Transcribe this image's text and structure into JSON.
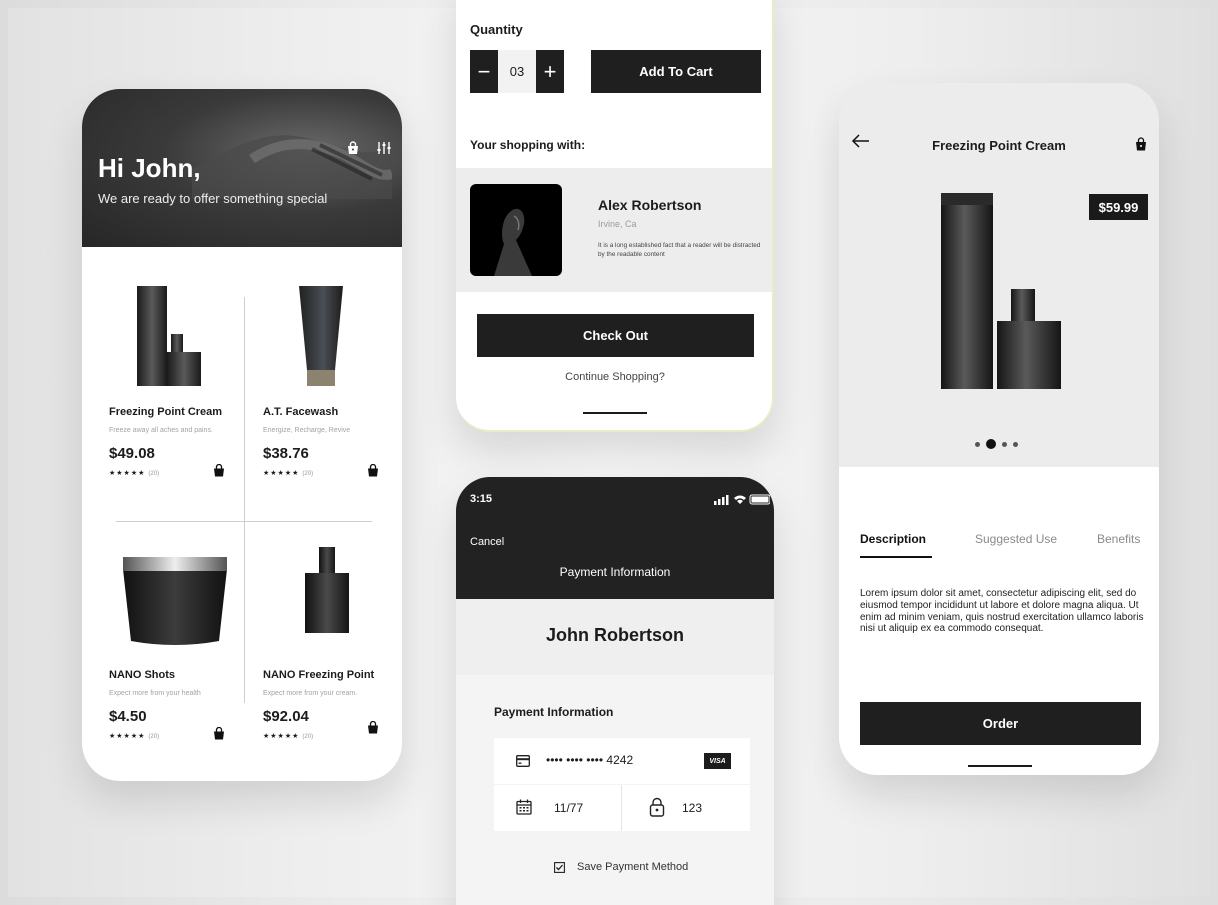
{
  "theme": {
    "dark": "#1f1f1f",
    "accent_border": "#e3efc6"
  },
  "home": {
    "greeting": "Hi John,",
    "subtitle": "We are ready to offer something special",
    "icons": [
      "shopping-bag-icon",
      "filter-icon"
    ],
    "products": [
      {
        "name": "Freezing Point Cream",
        "tagline": "Freeze away all aches and pains.",
        "price": "$49.08",
        "stars": "★★★★★",
        "reviews": "(20)"
      },
      {
        "name": "A.T. Facewash",
        "tagline": "Energize, Recharge, Revive",
        "price": "$38.76",
        "stars": "★★★★★",
        "reviews": "(20)"
      },
      {
        "name": "NANO Shots",
        "tagline": "Expect more from your health",
        "price": "$4.50",
        "stars": "★★★★★",
        "reviews": "(20)"
      },
      {
        "name": "NANO Freezing Point",
        "tagline": "Expect more from your cream.",
        "price": "$92.04",
        "stars": "★★★★★",
        "reviews": "(20)"
      }
    ]
  },
  "cart": {
    "quantity_label": "Quantity",
    "quantity_minus": "−",
    "quantity_value": "03",
    "quantity_plus": "+",
    "add_to_cart": "Add To Cart",
    "shopping_with_label": "Your shopping with:",
    "seller": {
      "name": "Alex Robertson",
      "location": "Irvine, Ca",
      "description": "It is a long established fact that a reader will be distracted by the readable content"
    },
    "checkout": "Check Out",
    "continue": "Continue Shopping?"
  },
  "payment": {
    "time": "3:15",
    "cancel": "Cancel",
    "title": "Payment Information",
    "holder": "John Robertson",
    "section_label": "Payment Information",
    "card_number": "•••• •••• •••• 4242",
    "card_brand": "VISA",
    "expiry": "11/77",
    "cvv": "123",
    "save_label": "Save Payment Method",
    "save_checked": true
  },
  "detail": {
    "title": "Freezing Point Cream",
    "price": "$59.99",
    "carousel_active": 2,
    "tabs": [
      "Description",
      "Suggested Use",
      "Benefits"
    ],
    "active_tab": "Description",
    "description": "Lorem ipsum dolor sit amet, consectetur adipiscing elit, sed do eiusmod tempor incididunt ut labore et dolore magna aliqua. Ut enim ad minim veniam, quis nostrud exercitation ullamco laboris nisi ut aliquip ex ea commodo consequat.",
    "order": "Order"
  }
}
